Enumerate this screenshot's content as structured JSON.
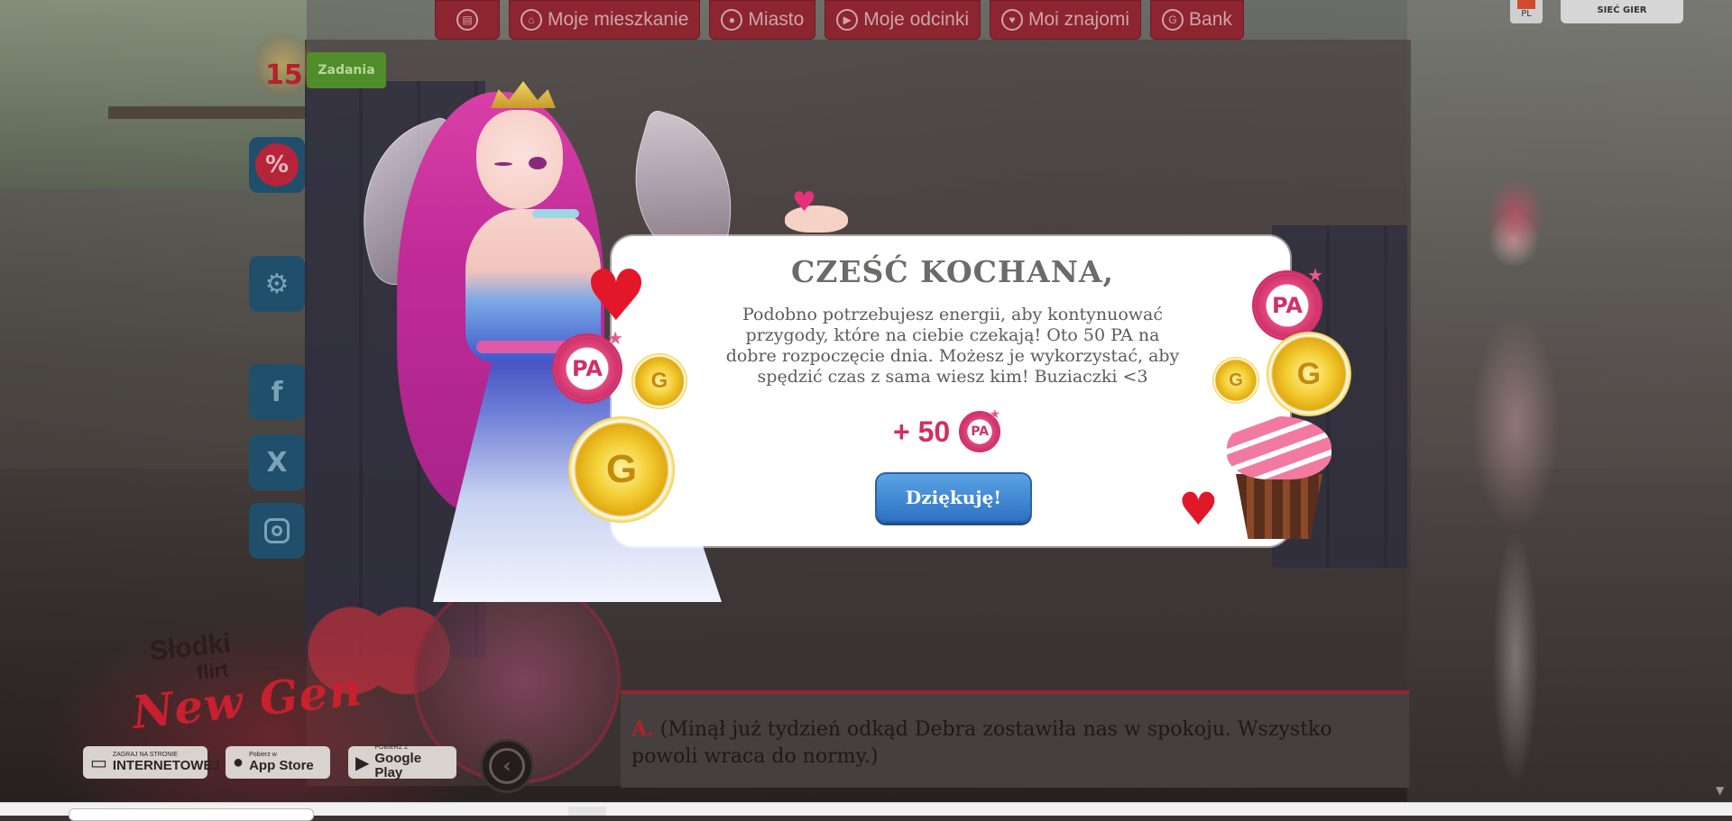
{
  "nav": {
    "items": [
      {
        "label": "",
        "icon": "book-icon"
      },
      {
        "label": "Moje mieszkanie",
        "icon": "home-icon"
      },
      {
        "label": "Miasto",
        "icon": "location-icon"
      },
      {
        "label": "Moje odcinki",
        "icon": "play-icon"
      },
      {
        "label": "Moi znajomi",
        "icon": "heart-icon"
      },
      {
        "label": "Bank",
        "icon": "coin-icon"
      }
    ],
    "language": "PL",
    "network_label": "SIEĆ GIER"
  },
  "sidebar": {
    "tasks_count": "15",
    "tasks_label": "Zadania",
    "promo_icon": "%",
    "settings_icon": "gear-icon",
    "facebook_icon": "f",
    "x_icon": "X",
    "instagram_icon": "instagram-icon"
  },
  "logo": {
    "line1": "Słodki",
    "line2": "flirt",
    "line3": "New Gen"
  },
  "stores": [
    {
      "small": "ZAGRAJ NA STRONIE",
      "big": "INTERNETOWEJ",
      "glyph": "▭"
    },
    {
      "small": "Pobierz w",
      "big": "App Store",
      "glyph": ""
    },
    {
      "small": "POBIERZ Z",
      "big": "Google Play",
      "glyph": "▶"
    }
  ],
  "dialogue": {
    "speaker": "A.",
    "text": "(Minął już tydzień odkąd Debra zostawiła nas w spokoju. Wszystko powoli wraca do normy.)"
  },
  "popup": {
    "title": "CZEŚĆ KOCHANA,",
    "message": "Podobno potrzebujesz energii, aby kontynuować przygody, które na ciebie czekają! Oto 50 PA na dobre rozpoczęcie dnia. Możesz je wykorzystać, aby spędzić czas z sama wiesz kim! Buziaczki <3",
    "reward_amount": "+ 50",
    "reward_currency": "PA",
    "button_label": "Dziękuję!"
  },
  "colors": {
    "accent_red": "#8c2530",
    "reward_pink": "#d42d5e",
    "button_blue": "#2e72c4"
  }
}
